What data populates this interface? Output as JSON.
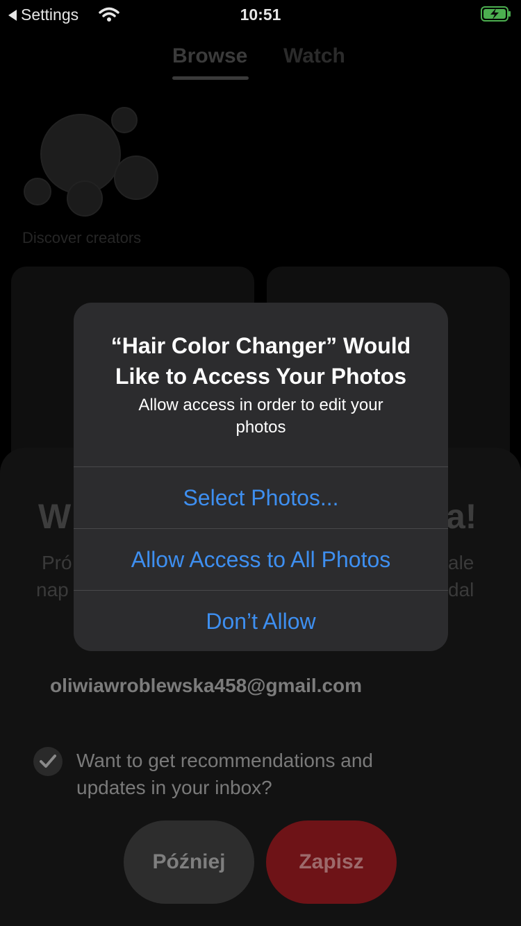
{
  "status_bar": {
    "back_label": "Settings",
    "time": "10:51",
    "battery_icon": "battery-charging-icon",
    "wifi_icon": "wifi-icon"
  },
  "tabs": [
    {
      "label": "Browse",
      "active": true
    },
    {
      "label": "Watch",
      "active": false
    }
  ],
  "creators": {
    "label": "Discover creators"
  },
  "sheet": {
    "title_left_fragment": "W",
    "title_right_fragment": "a!",
    "desc_left_line1": "Pró",
    "desc_left_line2": "nap",
    "desc_right_line1": "ale",
    "desc_right_line2": "dal",
    "email": "oliwiawroblewska458@gmail.com",
    "optin_text": "Want to get recommendations and updates in your inbox?",
    "optin_checked": true,
    "later_button": "Później",
    "save_button": "Zapisz",
    "save_color": "#6e1317"
  },
  "alert": {
    "title": "“Hair Color Changer” Would Like to Access Your Photos",
    "message": "Allow access in order to edit your photos",
    "buttons": [
      "Select Photos...",
      "Allow Access to All Photos",
      "Don’t Allow"
    ],
    "button_color": "#3e8ff0"
  }
}
